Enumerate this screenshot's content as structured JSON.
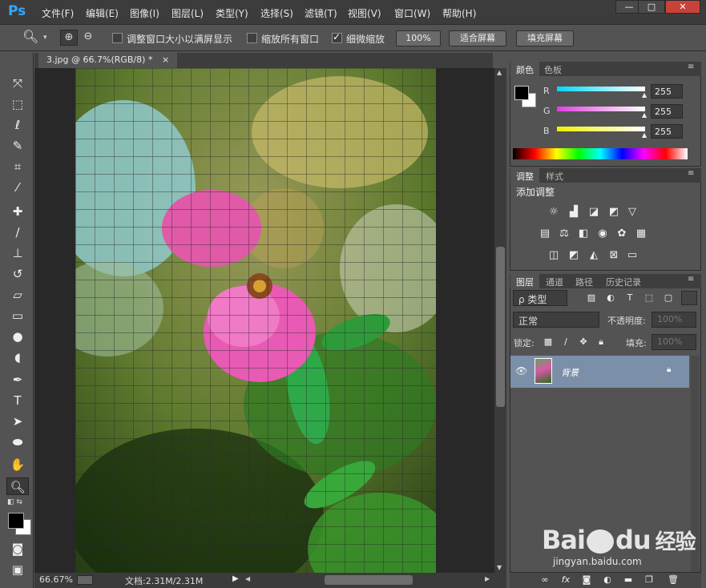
{
  "app": {
    "logo": "Ps"
  },
  "menu": [
    "文件(F)",
    "编辑(E)",
    "图像(I)",
    "图层(L)",
    "类型(Y)",
    "选择(S)",
    "滤镜(T)",
    "视图(V)",
    "窗口(W)",
    "帮助(H)"
  ],
  "window_controls": {
    "minimize": "—",
    "restore": "□",
    "close": "✕"
  },
  "options": {
    "resize_windows": "调整窗口大小以满屏显示",
    "zoom_all": "缩放所有窗口",
    "scrubby_zoom": "细微缩放",
    "btn_100": "100%",
    "btn_fit": "适合屏幕",
    "btn_fill": "填充屏幕"
  },
  "document": {
    "tab_title": "3.jpg @ 66.7%(RGB/8) *",
    "tab_close": "×"
  },
  "status": {
    "zoom": "66.67%",
    "doc_info": "文档:2.31M/2.31M"
  },
  "color_panel": {
    "tabs": [
      "颜色",
      "色板"
    ],
    "channels": [
      {
        "label": "R",
        "value": "255",
        "color": "#00d8ff"
      },
      {
        "label": "G",
        "value": "255",
        "color": "#e040e0"
      },
      {
        "label": "B",
        "value": "255",
        "color": "#f0f000"
      }
    ]
  },
  "adjust_panel": {
    "tabs": [
      "调整",
      "样式"
    ],
    "title": "添加调整"
  },
  "layers_panel": {
    "tabs": [
      "图层",
      "通道",
      "路径",
      "历史记录"
    ],
    "filter_kind": "ρ 类型",
    "blend_mode": "正常",
    "opacity_label": "不透明度:",
    "opacity_value": "100%",
    "lock_label": "锁定:",
    "fill_label": "填充:",
    "fill_value": "100%",
    "layer_name": "背景"
  },
  "watermark": {
    "brand": "Bai",
    "brand2": "du",
    "site": "经验",
    "url": "jingyan.baidu.com"
  }
}
